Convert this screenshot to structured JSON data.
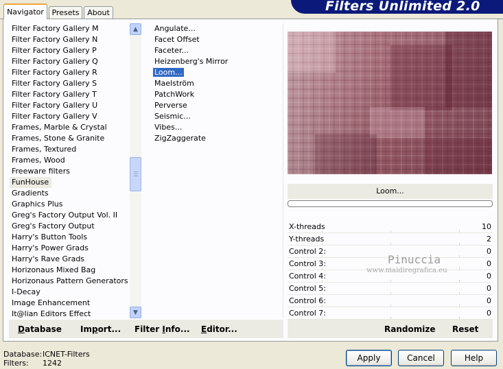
{
  "window": {
    "title": "Filters Unlimited 2.0"
  },
  "tabs": [
    {
      "label": "Navigator",
      "active": true
    },
    {
      "label": "Presets",
      "active": false
    },
    {
      "label": "About",
      "active": false
    }
  ],
  "categories": [
    "Filter Factory Gallery M",
    "Filter Factory Gallery N",
    "Filter Factory Gallery P",
    "Filter Factory Gallery Q",
    "Filter Factory Gallery R",
    "Filter Factory Gallery S",
    "Filter Factory Gallery T",
    "Filter Factory Gallery U",
    "Filter Factory Gallery V",
    "Frames, Marble & Crystal",
    "Frames, Stone & Granite",
    "Frames, Textured",
    "Frames, Wood",
    "Freeware filters",
    "FunHouse",
    "Gradients",
    "Graphics Plus",
    "Greg's Factory Output Vol. II",
    "Greg's Factory Output",
    "Harry's Button Tools",
    "Harry's Power Grads",
    "Harry's Rave Grads",
    "Horizonaus Mixed Bag",
    "Horizonaus Pattern Generators",
    "I-Decay",
    "Image Enhancement",
    "It@lian Editors Effect"
  ],
  "selected_category": "FunHouse",
  "filters": [
    "Angulate...",
    "Facet Offset",
    "Faceter...",
    "Heizenberg's Mirror",
    "Loom...",
    "Maelström",
    "PatchWork",
    "Perverse",
    "Seismic...",
    "Vibes...",
    "ZigZaggerate"
  ],
  "selected_filter": "Loom...",
  "preview": {
    "filter_name": "Loom...",
    "base_color": "#9e5d6a",
    "progress": 0
  },
  "controls": [
    {
      "label": "X-threads",
      "value": "10"
    },
    {
      "label": "Y-threads",
      "value": "2"
    },
    {
      "label": "Control 2:",
      "value": "0"
    },
    {
      "label": "Control 3:",
      "value": "0"
    },
    {
      "label": "Control 4:",
      "value": "0"
    },
    {
      "label": "Control 5:",
      "value": "0"
    },
    {
      "label": "Control 6:",
      "value": "0"
    },
    {
      "label": "Control 7:",
      "value": "0"
    }
  ],
  "watermark": {
    "name": "Pinuccia",
    "url": "www.maidiregrafica.eu"
  },
  "left_bar": {
    "database": {
      "prefix": "",
      "u": "D",
      "rest": "atabase"
    },
    "import": {
      "prefix": "Im",
      "u": "p",
      "rest": "ort..."
    },
    "filter_info": {
      "prefix": "Filter ",
      "u": "I",
      "rest": "nfo..."
    },
    "editor": {
      "prefix": "",
      "u": "E",
      "rest": "ditor..."
    }
  },
  "right_bar": {
    "randomize": "Randomize",
    "reset": "Reset"
  },
  "status": {
    "database_label": "Database:",
    "database_value": "ICNET-Filters",
    "filters_label": "Filters:",
    "filters_value": "1242"
  },
  "buttons": {
    "apply": "Apply",
    "cancel": "Cancel",
    "help": "Help"
  }
}
